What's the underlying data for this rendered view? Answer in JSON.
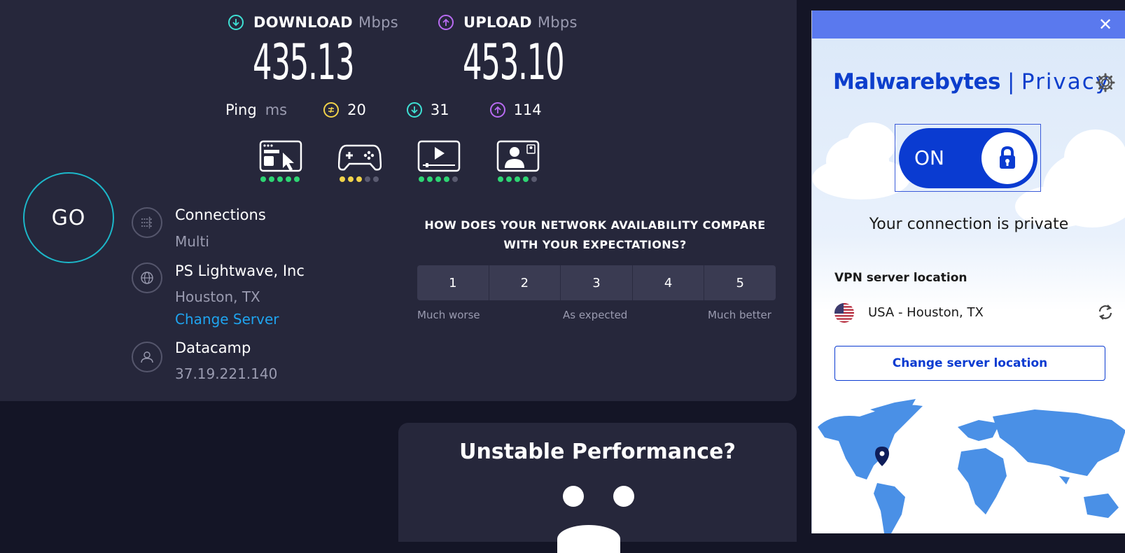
{
  "speedtest": {
    "download": {
      "label": "DOWNLOAD",
      "unit": "Mbps",
      "value": "435.13",
      "color": "#3ee0d4"
    },
    "upload": {
      "label": "UPLOAD",
      "unit": "Mbps",
      "value": "453.10",
      "color": "#b86bf2"
    },
    "ping": {
      "label": "Ping",
      "unit": "ms",
      "idle": {
        "value": "20",
        "color": "#f1d34a",
        "icon": "jitter-icon"
      },
      "download": {
        "value": "31",
        "color": "#3ee0d4",
        "icon": "download-arrow-icon"
      },
      "upload": {
        "value": "114",
        "color": "#b86bf2",
        "icon": "upload-arrow-icon"
      }
    },
    "app_ratings": [
      {
        "icon": "web-browsing-icon",
        "score": 5,
        "color": "#2ed573"
      },
      {
        "icon": "gaming-icon",
        "score": 3,
        "color": "#f1d34a"
      },
      {
        "icon": "streaming-icon",
        "score": 4,
        "color": "#2ed573"
      },
      {
        "icon": "video-call-icon",
        "score": 4,
        "color": "#2ed573"
      }
    ],
    "go_label": "GO",
    "connections": {
      "title": "Connections",
      "value": "Multi"
    },
    "server": {
      "title": "PS Lightwave, Inc",
      "location": "Houston, TX",
      "change_label": "Change Server"
    },
    "isp": {
      "title": "Datacamp",
      "ip": "37.19.221.140"
    },
    "survey": {
      "question": "HOW DOES YOUR NETWORK AVAILABILITY COMPARE WITH YOUR EXPECTATIONS?",
      "options": [
        "1",
        "2",
        "3",
        "4",
        "5"
      ],
      "low_label": "Much worse",
      "mid_label": "As expected",
      "high_label": "Much better"
    },
    "promo_title": "Unstable Performance?"
  },
  "vpn": {
    "brand": "Malwarebytes",
    "product": "Privacy",
    "toggle_label": "ON",
    "status": "Your connection is private",
    "location_label": "VPN server location",
    "location_value": "USA - Houston, TX",
    "change_button": "Change server location",
    "accent": "#0a3bd1",
    "titlebar_color": "#5a79ee"
  }
}
